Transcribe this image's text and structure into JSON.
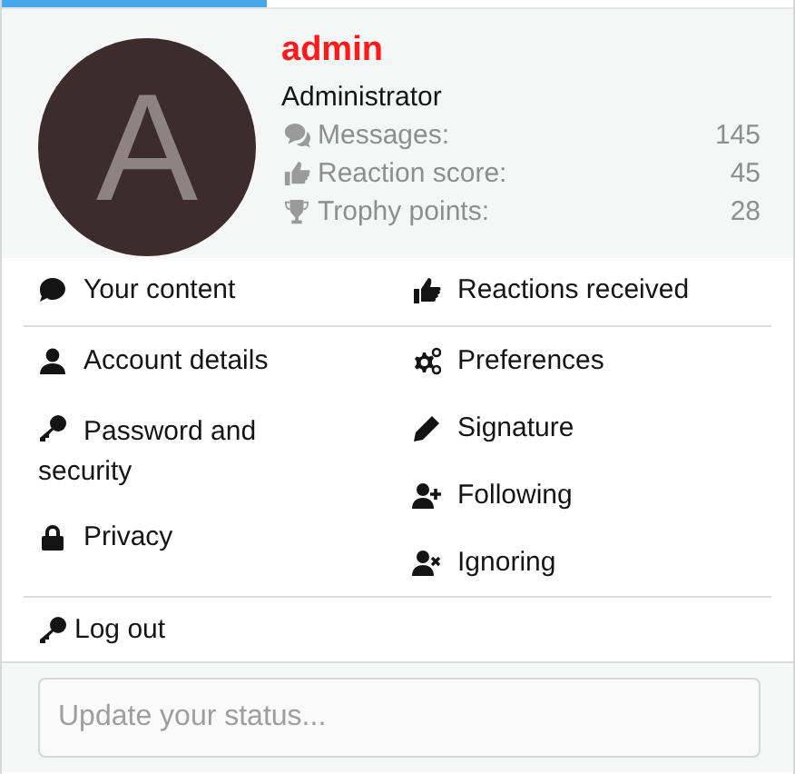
{
  "profile": {
    "avatar_letter": "A",
    "name": "admin",
    "title": "Administrator",
    "stats": [
      {
        "kind": "comments",
        "label": "Messages:",
        "value": "145"
      },
      {
        "kind": "thumbs",
        "label": "Reaction score:",
        "value": "45"
      },
      {
        "kind": "trophy",
        "label": "Trophy points:",
        "value": "28"
      }
    ]
  },
  "menu": {
    "top": [
      {
        "kind": "comment",
        "label": "Your content"
      },
      {
        "kind": "thumbs",
        "label": "Reactions received"
      }
    ],
    "left": [
      {
        "kind": "user",
        "label": "Account details"
      },
      {
        "kind": "key",
        "label": "Password and security"
      },
      {
        "kind": "lock",
        "label": "Privacy"
      }
    ],
    "right": [
      {
        "kind": "cogs",
        "label": "Preferences"
      },
      {
        "kind": "pencil",
        "label": "Signature"
      },
      {
        "kind": "user-plus",
        "label": "Following"
      },
      {
        "kind": "user-x",
        "label": "Ignoring"
      }
    ]
  },
  "logout": {
    "kind": "key",
    "label": "Log out"
  },
  "status": {
    "placeholder": "Update your status..."
  }
}
